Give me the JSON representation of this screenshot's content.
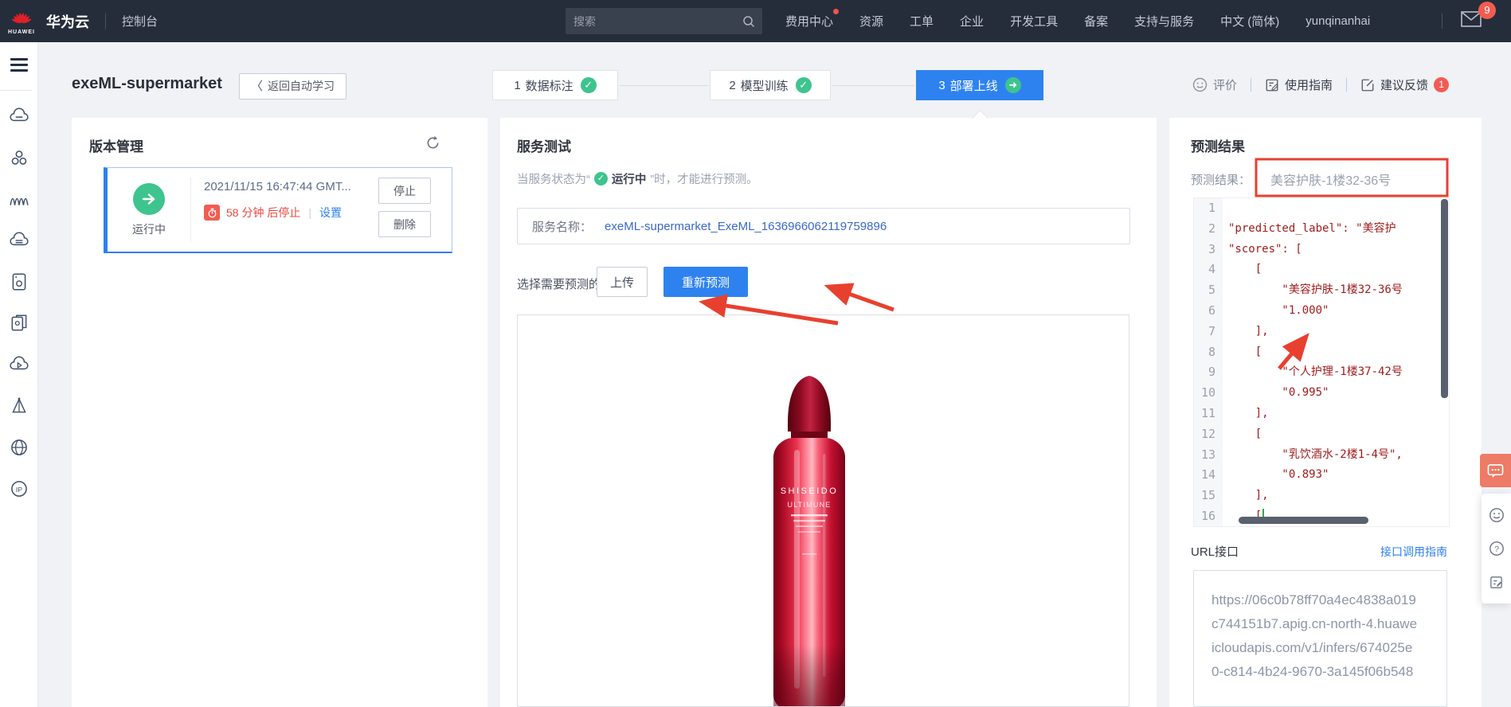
{
  "colors": {
    "accent_blue": "#2e82f0",
    "green": "#3ec48e",
    "annotation_red": "#e8402f",
    "code_red": "#a01d1d",
    "salmon": "#ed7b67",
    "topbar_bg": "#262d3a"
  },
  "topbar": {
    "logo_text": "HUAWEI",
    "brand": "华为云",
    "console": "控制台",
    "search_placeholder": "搜索",
    "menu": [
      {
        "label": "费用中心",
        "dot": true
      },
      {
        "label": "资源"
      },
      {
        "label": "工单"
      },
      {
        "label": "企业"
      },
      {
        "label": "开发工具"
      },
      {
        "label": "备案"
      },
      {
        "label": "支持与服务"
      },
      {
        "label": "中文 (简体)"
      },
      {
        "label": "yunqinanhai"
      }
    ],
    "mail_badge": "9"
  },
  "sidebar": {
    "icons": [
      "cloud-server-icon",
      "cluster-icon",
      "waves-icon",
      "cloud-db-icon",
      "server-icon",
      "copy-docs-icon",
      "cloud-media-icon",
      "vector-icon",
      "globe-icon",
      "ip-icon"
    ]
  },
  "header": {
    "title": "exeML-supermarket",
    "back_button": "返回自动学习",
    "steps": [
      {
        "num": "1",
        "label": "数据标注"
      },
      {
        "num": "2",
        "label": "模型训练"
      },
      {
        "num": "3",
        "label": "部署上线"
      }
    ],
    "rate": "评价",
    "guide": "使用指南",
    "feedback": "建议反馈",
    "feedback_badge": "1"
  },
  "version_panel": {
    "title": "版本管理",
    "status": "运行中",
    "time": "2021/11/15 16:47:44 GMT...",
    "countdown": "58 分钟 后停止",
    "settings_link": "设置",
    "stop_button": "停止",
    "delete_button": "删除"
  },
  "service_panel": {
    "title": "服务测试",
    "hint_prefix": "当服务状态为“",
    "hint_status": "运行中",
    "hint_suffix": "”时，才能进行预测。",
    "name_label": "服务名称：",
    "name_value": "exeML-supermarket_ExeML_1636966062119759896",
    "file_label": "选择需要预测的文件",
    "upload_button": "上传",
    "repredict_button": "重新预测",
    "bottle_brand": "SHISEIDO",
    "bottle_product": "ULTIMUNE"
  },
  "result_panel": {
    "title": "预测结果",
    "result_label": "预测结果：",
    "result_value": "美容护肤-1楼32-36号",
    "code_lines": [
      "",
      "\"predicted_label\": \"美容护",
      "\"scores\": [",
      "    [",
      "        \"美容护肤-1楼32-36号",
      "        \"1.000\"",
      "    ],",
      "    [",
      "        \"个人护理-1楼37-42号",
      "        \"0.995\"",
      "    ],",
      "    [",
      "        \"乳饮酒水-2楼1-4号\",",
      "        \"0.893\"",
      "    ],",
      "    ["
    ],
    "cursor_line": 16,
    "url_label": "URL接口",
    "url_guide_link": "接口调用指南",
    "url_lines": [
      "https://06c0b78ff70a4ec4838a019",
      "c744151b7.apig.cn-north-4.huawe",
      "icloudapis.com/v1/infers/674025e",
      "0-c814-4b24-9670-3a145f06b548"
    ]
  }
}
